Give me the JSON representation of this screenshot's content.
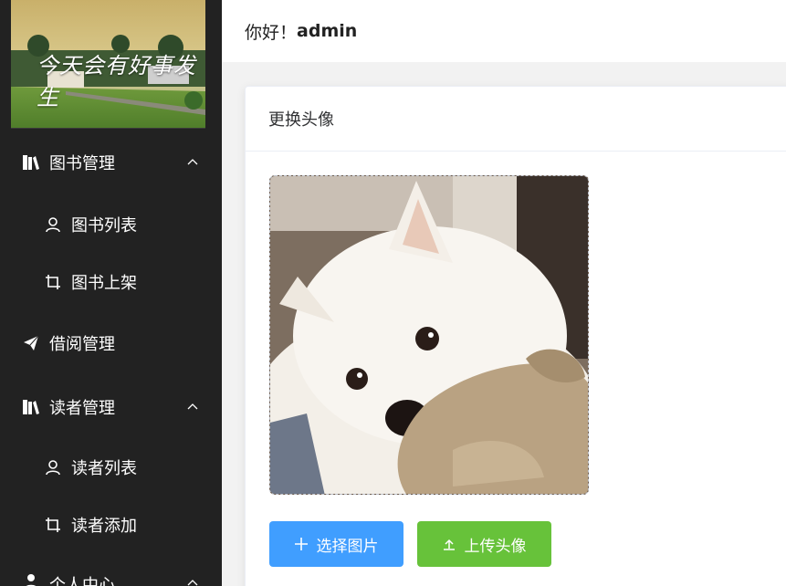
{
  "header": {
    "greeting": "你好！",
    "username": "admin"
  },
  "sidebar": {
    "banner_text": "今天会有好事发生",
    "items": [
      {
        "label": "图书管理",
        "icon": "book-icon",
        "expanded": true
      },
      {
        "label": "图书列表",
        "icon": "user-icon"
      },
      {
        "label": "图书上架",
        "icon": "crop-icon"
      },
      {
        "label": "借阅管理",
        "icon": "send-icon"
      },
      {
        "label": "读者管理",
        "icon": "book-icon",
        "expanded": true
      },
      {
        "label": "读者列表",
        "icon": "user-icon"
      },
      {
        "label": "读者添加",
        "icon": "crop-icon"
      },
      {
        "label": "个人中心",
        "icon": "user-solid-icon",
        "expanded": true
      }
    ]
  },
  "card": {
    "title": "更换头像",
    "select_button": "选择图片",
    "upload_button": "上传头像"
  },
  "colors": {
    "sidebar_bg": "#222222",
    "primary": "#409eff",
    "success": "#67c23a"
  }
}
